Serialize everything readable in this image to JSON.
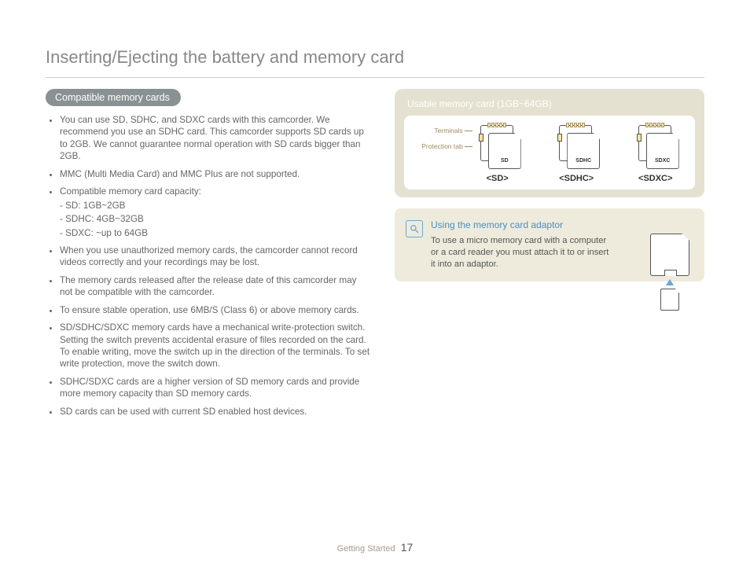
{
  "title": "Inserting/Ejecting the battery and memory card",
  "section_heading": "Compatible memory cards",
  "bullets": [
    "You can use SD, SDHC, and SDXC cards with this camcorder. We recommend you use an SDHC card. This camcorder supports SD cards up to 2GB. We cannot guarantee normal operation with SD cards bigger than 2GB.",
    "MMC (Multi Media Card) and MMC Plus are not supported.",
    "Compatible memory card capacity:",
    "When you use unauthorized memory cards, the camcorder cannot record videos correctly and your recordings may be lost.",
    "The memory cards released after the release date of this camcorder may not be compatible with the camcorder.",
    "To ensure stable operation, use 6MB/S (Class 6) or above memory cards.",
    "SD/SDHC/SDXC memory cards have a mechanical write-protection switch. Setting the switch prevents accidental erasure of files recorded on the card. To enable writing, move the switch up in the direction of the terminals. To set write protection, move the switch down.",
    "SDHC/SDXC cards are a higher version of SD memory cards and provide more memory capacity than SD memory cards.",
    "SD cards can be used with current SD enabled host devices."
  ],
  "capacity_sub": [
    "- SD: 1GB~2GB",
    "- SDHC: 4GB~32GB",
    "- SDXC: ~up to 64GB"
  ],
  "usable_box": {
    "title": "Usable memory card (1GB~64GB)",
    "annot_terminals": "Terminals",
    "annot_protect": "Protection tab",
    "types": {
      "sd": "<SD>",
      "sdhc": "<SDHC>",
      "sdxc": "<SDXC>"
    }
  },
  "note": {
    "title": "Using the memory card adaptor",
    "text": "To use a micro memory card with a computer or a card reader you must attach it to or insert it into an adaptor."
  },
  "footer": {
    "section": "Getting Started",
    "page": "17"
  }
}
